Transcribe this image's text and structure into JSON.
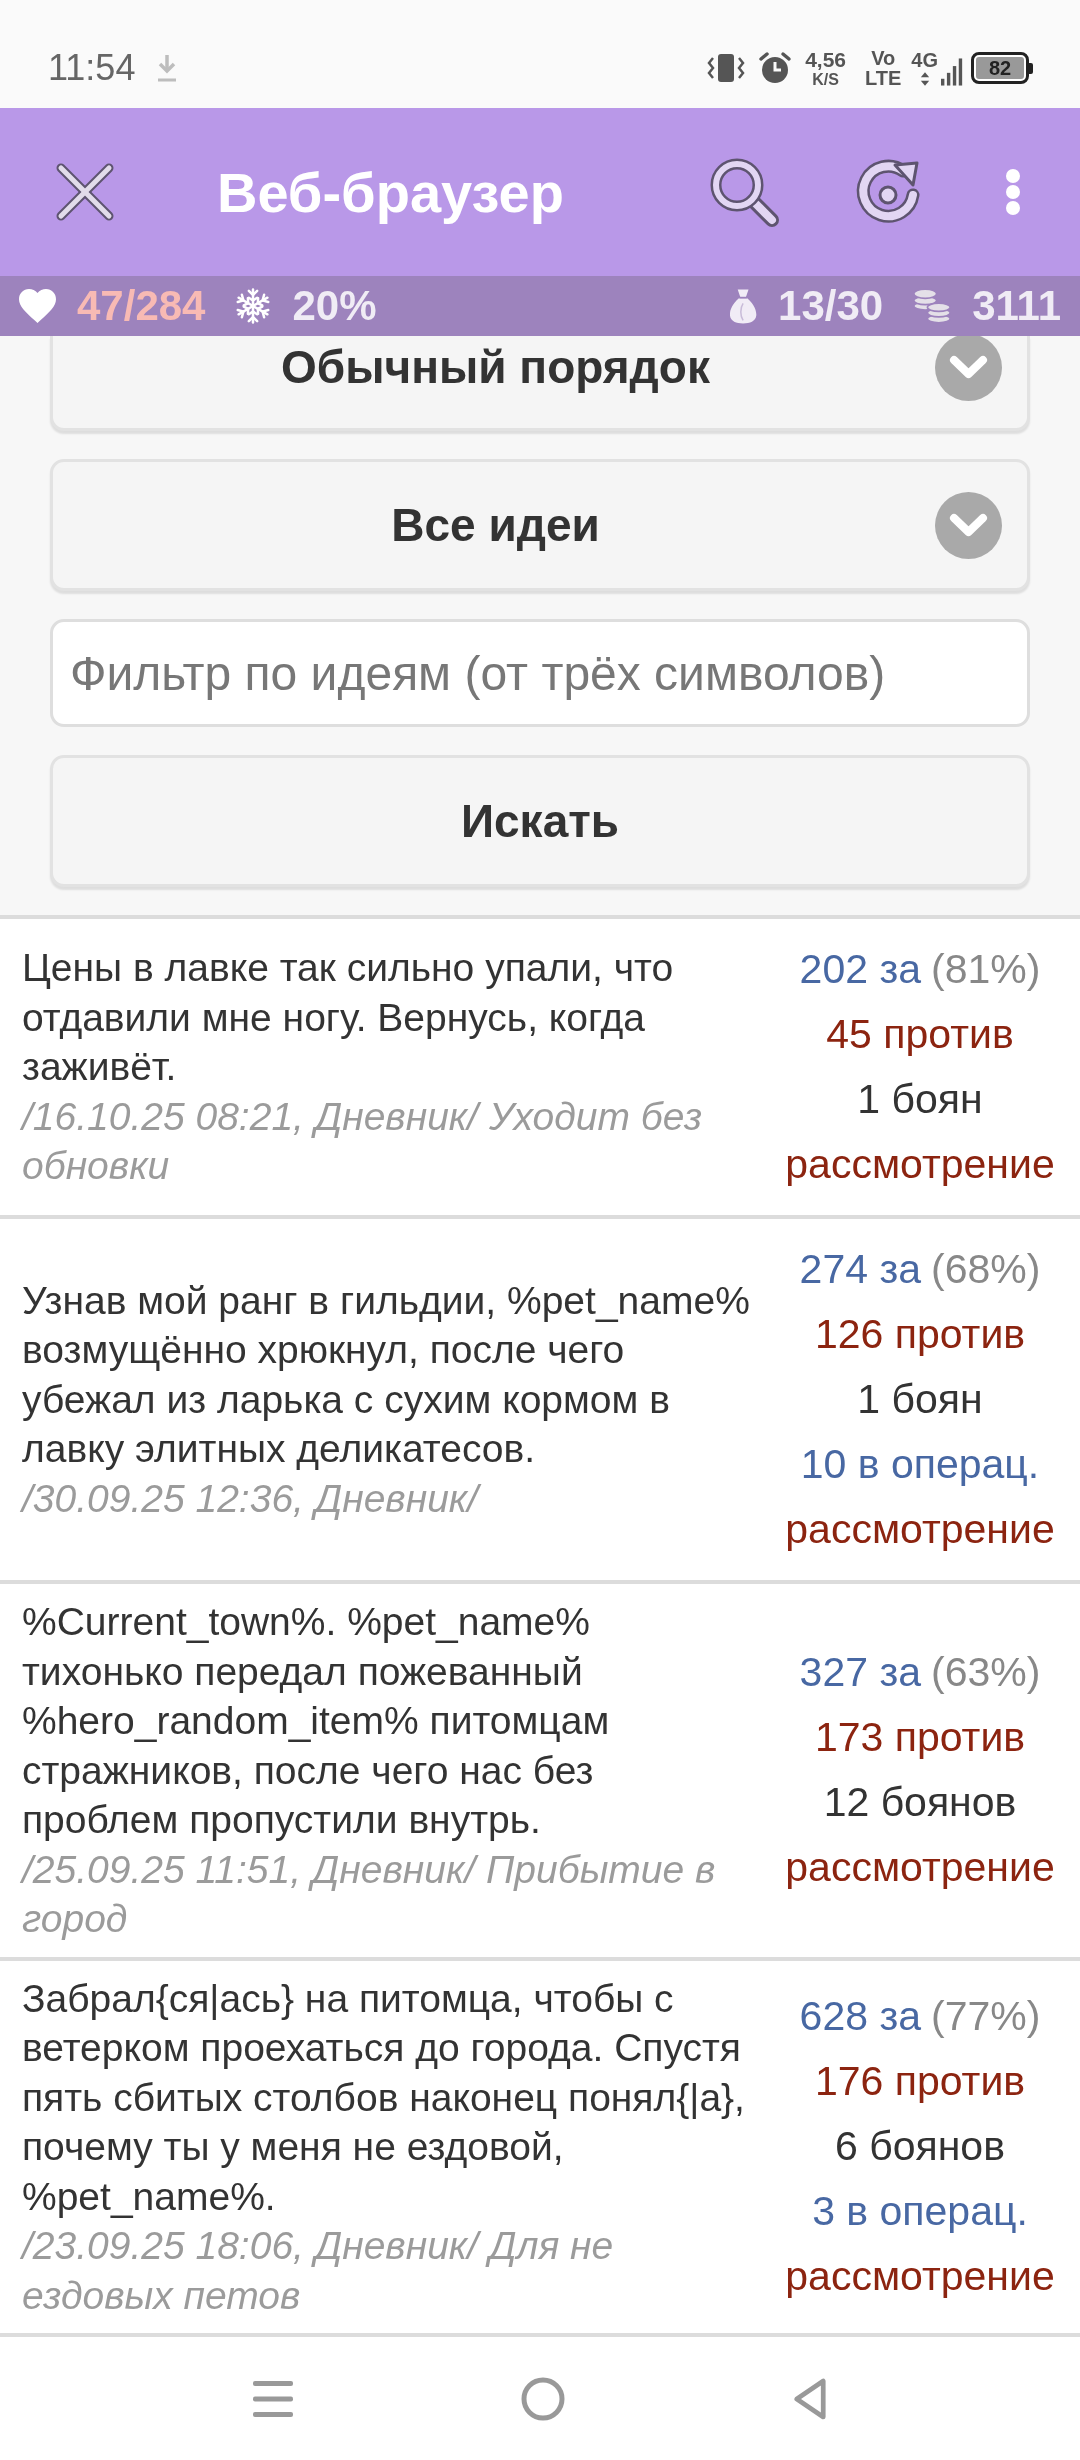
{
  "status_bar": {
    "time": "11:54",
    "speed": "4,56",
    "speed_unit": "K/S",
    "volte_top": "Vo",
    "volte_bottom": "LTE",
    "network": "4G",
    "battery": "82"
  },
  "app_bar": {
    "title": "Веб-браузер"
  },
  "stats": {
    "left": [
      {
        "kind": "heart",
        "value": "47/284"
      },
      {
        "kind": "snowflake",
        "value": "20%"
      }
    ],
    "right": [
      {
        "kind": "sack",
        "value": "13/30"
      },
      {
        "kind": "coins",
        "value": "3111"
      }
    ]
  },
  "filters": {
    "dropdowns": [
      {
        "value": "Обычный порядок"
      },
      {
        "value": "Все идеи"
      }
    ],
    "search_field": {
      "placeholder": "Фильтр по идеям (от трёх символов)"
    },
    "search_button": {
      "label": "Искать"
    }
  },
  "ideas": [
    {
      "text": "Цены в лавке так сильно упали, что отдавили мне ногу. Вернусь, когда заживёт.",
      "source": "/16.10.25 08:21, Дневник/ Уходит без обновки",
      "tallies": [
        {
          "kind": "for",
          "text": "202 за",
          "share": "(81%)"
        },
        {
          "kind": "against",
          "text": "45 против"
        },
        {
          "kind": "bayan",
          "text": "1 боян"
        },
        {
          "kind": "status",
          "text": "рассмотрение"
        }
      ]
    },
    {
      "text": "Узнав мой ранг в гильдии, %pet_name% возмущённо хрюкнул, после чего убежал из ларька с сухим кормом в лавку элитных деликатесов.",
      "source": "/30.09.25 12:36, Дневник/",
      "tallies": [
        {
          "kind": "for",
          "text": "274 за",
          "share": "(68%)"
        },
        {
          "kind": "against",
          "text": "126 против"
        },
        {
          "kind": "bayan",
          "text": "1 боян"
        },
        {
          "kind": "operation",
          "text": "10 в операц."
        },
        {
          "kind": "status",
          "text": "рассмотрение"
        }
      ]
    },
    {
      "text": "%Current_town%. %pet_name% тихонько передал пожеванный %hero_random_item% питомцам стражников, после чего нас без проблем пропустили внутрь.",
      "source": "/25.09.25 11:51, Дневник/ Прибытие в город",
      "tallies": [
        {
          "kind": "for",
          "text": "327 за",
          "share": "(63%)"
        },
        {
          "kind": "against",
          "text": "173 против"
        },
        {
          "kind": "bayan",
          "text": "12 боянов"
        },
        {
          "kind": "status",
          "text": "рассмотрение"
        }
      ]
    },
    {
      "text": "Забрал{ся|ась} на питомца, чтобы с ветерком проехаться до города. Спустя пять сбитых столбов наконец понял{|а}, почему ты у меня не ездовой, %pet_name%.",
      "source": "/23.09.25 18:06, Дневник/ Для не ездовых петов",
      "tallies": [
        {
          "kind": "for",
          "text": "628 за",
          "share": "(77%)"
        },
        {
          "kind": "against",
          "text": "176 против"
        },
        {
          "kind": "bayan",
          "text": "6 боянов"
        },
        {
          "kind": "operation",
          "text": "3 в операц."
        },
        {
          "kind": "status",
          "text": "рассмотрение"
        }
      ]
    }
  ]
}
